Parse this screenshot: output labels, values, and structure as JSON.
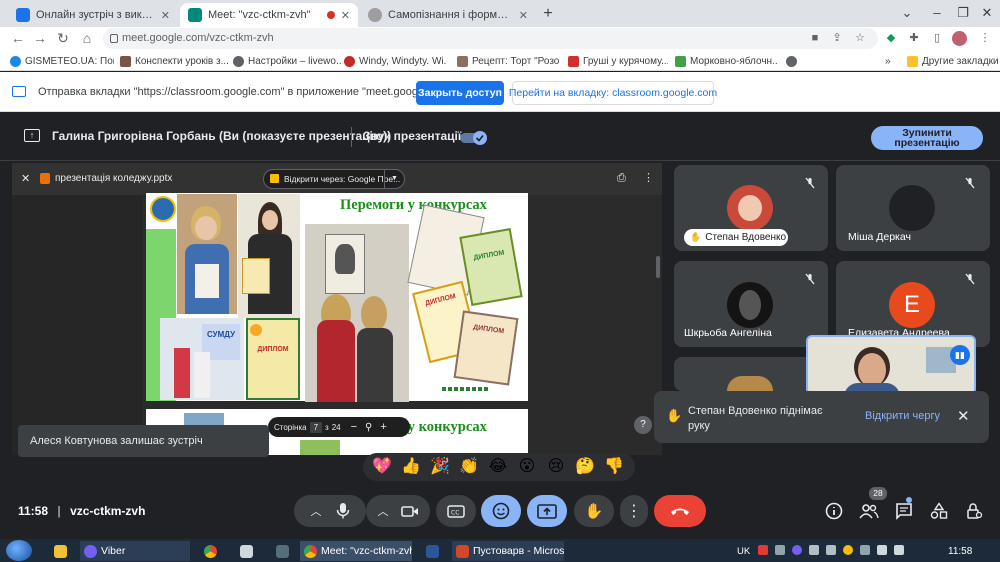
{
  "browser": {
    "tabs": [
      {
        "label": "Онлайн зустріч з викладача",
        "favicon": "classroom-icon",
        "color": "#1a73e8"
      },
      {
        "label": "Meet: \"vzc-ctkm-zvh\"",
        "favicon": "meet-icon",
        "color": "#00897b"
      },
      {
        "label": "Самопізнання і формування осо",
        "favicon": "generic-icon",
        "color": "#9e9e9e"
      }
    ],
    "url": "meet.google.com/vzc-ctkm-zvh",
    "bookmarks": [
      "GISMETEO.UA: Пог...",
      "Конспекти уроків з...",
      "Настройки – livewo...",
      "Windy, Windyty. Wi...",
      "Рецепт: Торт \"Розо...",
      "Груші у курячому...",
      "Морковно-яблочн..."
    ],
    "other_bookmarks": "Другие закладки"
  },
  "infobar": {
    "text": "Отправка вкладки \"https://classroom.google.com\" в приложение \"meet.google.com\"...",
    "grant_label": "Закрыть доступ",
    "switch_label": "Перейти на вкладку: classroom.google.com"
  },
  "presentation_bar": {
    "label": "Галина Григорівна Горбань (Ви (показуєте презентацію))",
    "sound_label": "Звук презентації",
    "stop_label_line1": "Зупинити",
    "stop_label_line2": "презентацію"
  },
  "shared": {
    "file_name": "презентація коледжу.pptx",
    "open_with": "Відкрити через: Google Пре...",
    "slide_title": "Перемоги у конкурсах",
    "page_label": "Сторінка",
    "page_current": "7",
    "page_of": "з",
    "page_total": "24"
  },
  "participants": [
    {
      "name": "Степан Вдовенко",
      "raised": true
    },
    {
      "name": "Міша Деркач"
    },
    {
      "name": "Шкрьоба Ангеліна"
    },
    {
      "name": "Елизавета Андреева",
      "initial": "E",
      "color": "#e8491d"
    }
  ],
  "notifications": {
    "left_toast": "Алеся Ковтунова залишає зустріч",
    "hand_text": "Степан Вдовенко піднімає руку",
    "open_queue": "Відкрити чергу"
  },
  "reactions": [
    "💖",
    "👍",
    "🎉",
    "👏",
    "😂",
    "😮",
    "😢",
    "🤔",
    "👎"
  ],
  "bottom": {
    "time": "11:58",
    "meeting_code": "vzc-ctkm-zvh",
    "participants_count": "28"
  },
  "taskbar": {
    "viber": "Viber",
    "meet": "Meet: \"vzc-ctkm-zvh\"...",
    "ppt": "Пустоварв - Microsof...",
    "lang": "UK",
    "time": "11:58"
  }
}
